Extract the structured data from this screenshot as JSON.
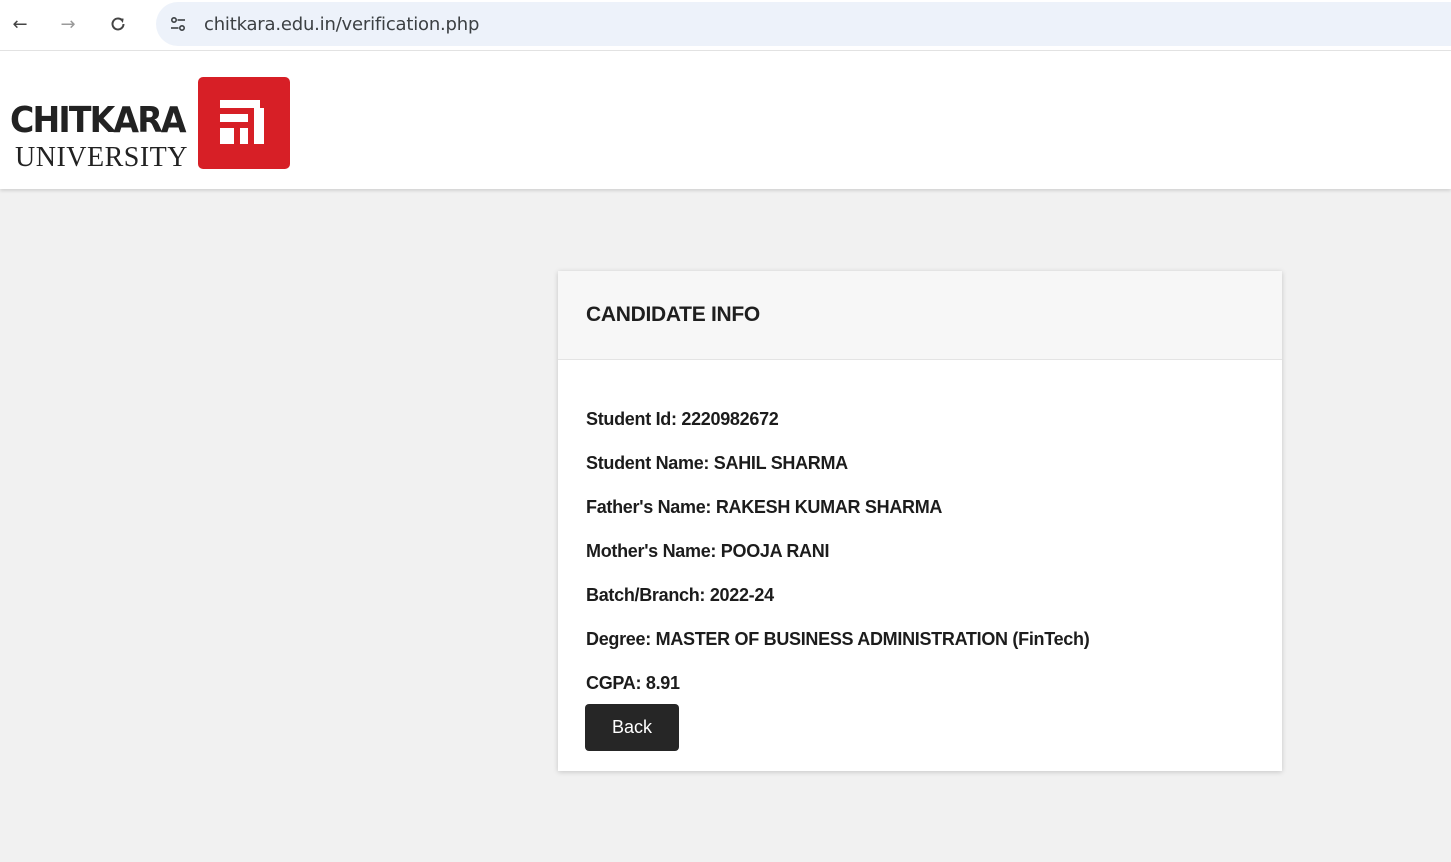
{
  "browser": {
    "url": "chitkara.edu.in/verification.php",
    "back_icon": "arrow-left-icon",
    "forward_icon": "arrow-right-icon",
    "reload_icon": "reload-icon",
    "site_info_icon": "tune-icon"
  },
  "logo": {
    "wordmark": "CHITKARA",
    "sub": "UNIVERSITY",
    "brand_color": "#d71f26"
  },
  "card": {
    "title": "CANDIDATE INFO",
    "lines": [
      "Student Id: 2220982672",
      "Student Name: SAHIL SHARMA",
      "Father's Name: RAKESH KUMAR SHARMA",
      "Mother's Name: POOJA RANI",
      "Batch/Branch: 2022-24",
      "Degree: MASTER OF BUSINESS ADMINISTRATION (FinTech)",
      "CGPA: 8.91"
    ],
    "back_label": "Back"
  }
}
